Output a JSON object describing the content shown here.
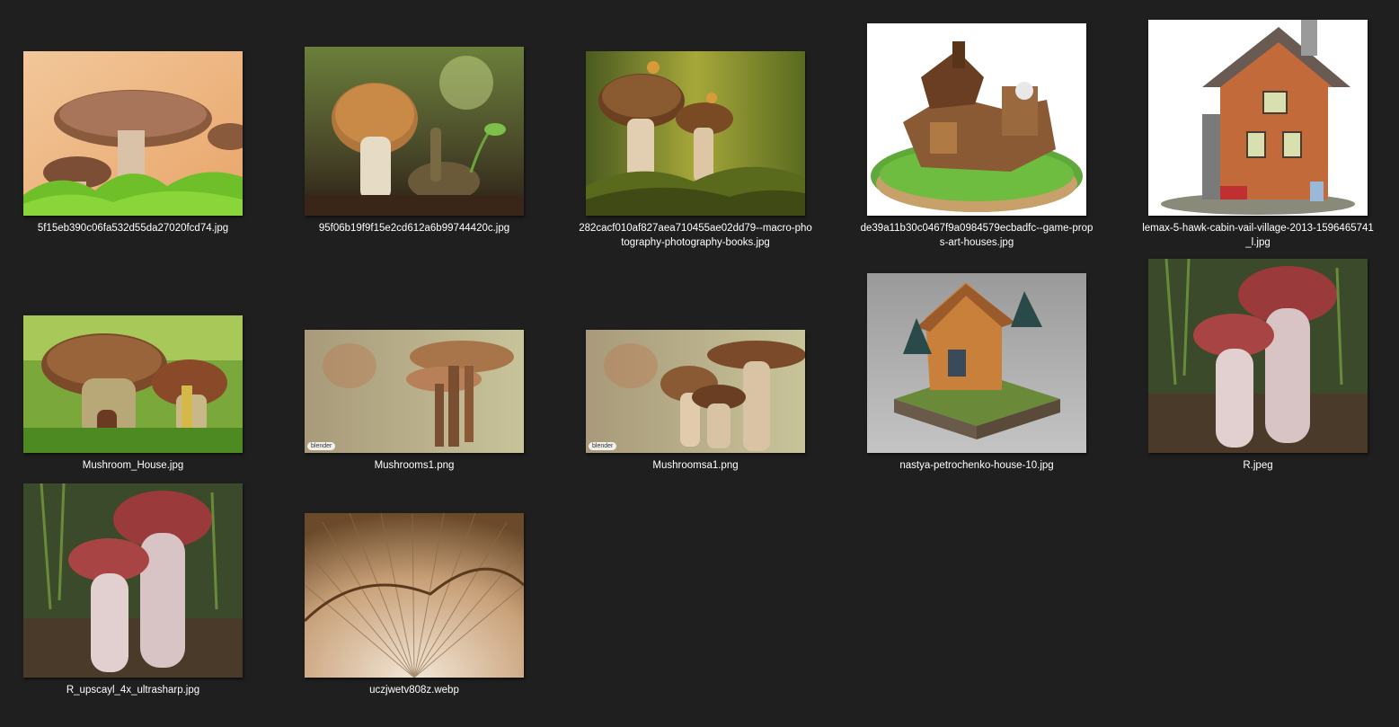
{
  "files": [
    {
      "name": "5f15eb390c06fa532d55da27020fcd74.jpg",
      "icon": "shiitake-mushroom-photo"
    },
    {
      "name": "95f06b19f9f15e2cd612a6b99744420c.jpg",
      "icon": "mushroom-snail-photo"
    },
    {
      "name": "282cacf010af827aea710455ae02dd79--macro-photography-photography-books.jpg",
      "icon": "mushrooms-moss-photo"
    },
    {
      "name": "de39a11b30c0467f9a0984579ecbadfc--game-props-art-houses.jpg",
      "icon": "game-house-art"
    },
    {
      "name": "lemax-5-hawk-cabin-vail-village-2013-1596465741_l.jpg",
      "icon": "cabin-figurine-photo"
    },
    {
      "name": "Mushroom_House.jpg",
      "icon": "mushroom-house-photo"
    },
    {
      "name": "Mushrooms1.png",
      "icon": "blender-mushrooms-render",
      "badge": "blender"
    },
    {
      "name": "Mushroomsa1.png",
      "icon": "blender-mushrooms-render",
      "badge": "blender"
    },
    {
      "name": "nastya-petrochenko-house-10.jpg",
      "icon": "isometric-house-art"
    },
    {
      "name": "R.jpeg",
      "icon": "porcini-mushroom-photo"
    },
    {
      "name": "R_upscayl_4x_ultrasharp.jpg",
      "icon": "porcini-mushroom-photo"
    },
    {
      "name": "uczjwetv808z.webp",
      "icon": "mushroom-gills-photo"
    }
  ],
  "colors": {
    "background": "#1f1f1f",
    "label": "#ffffff"
  }
}
